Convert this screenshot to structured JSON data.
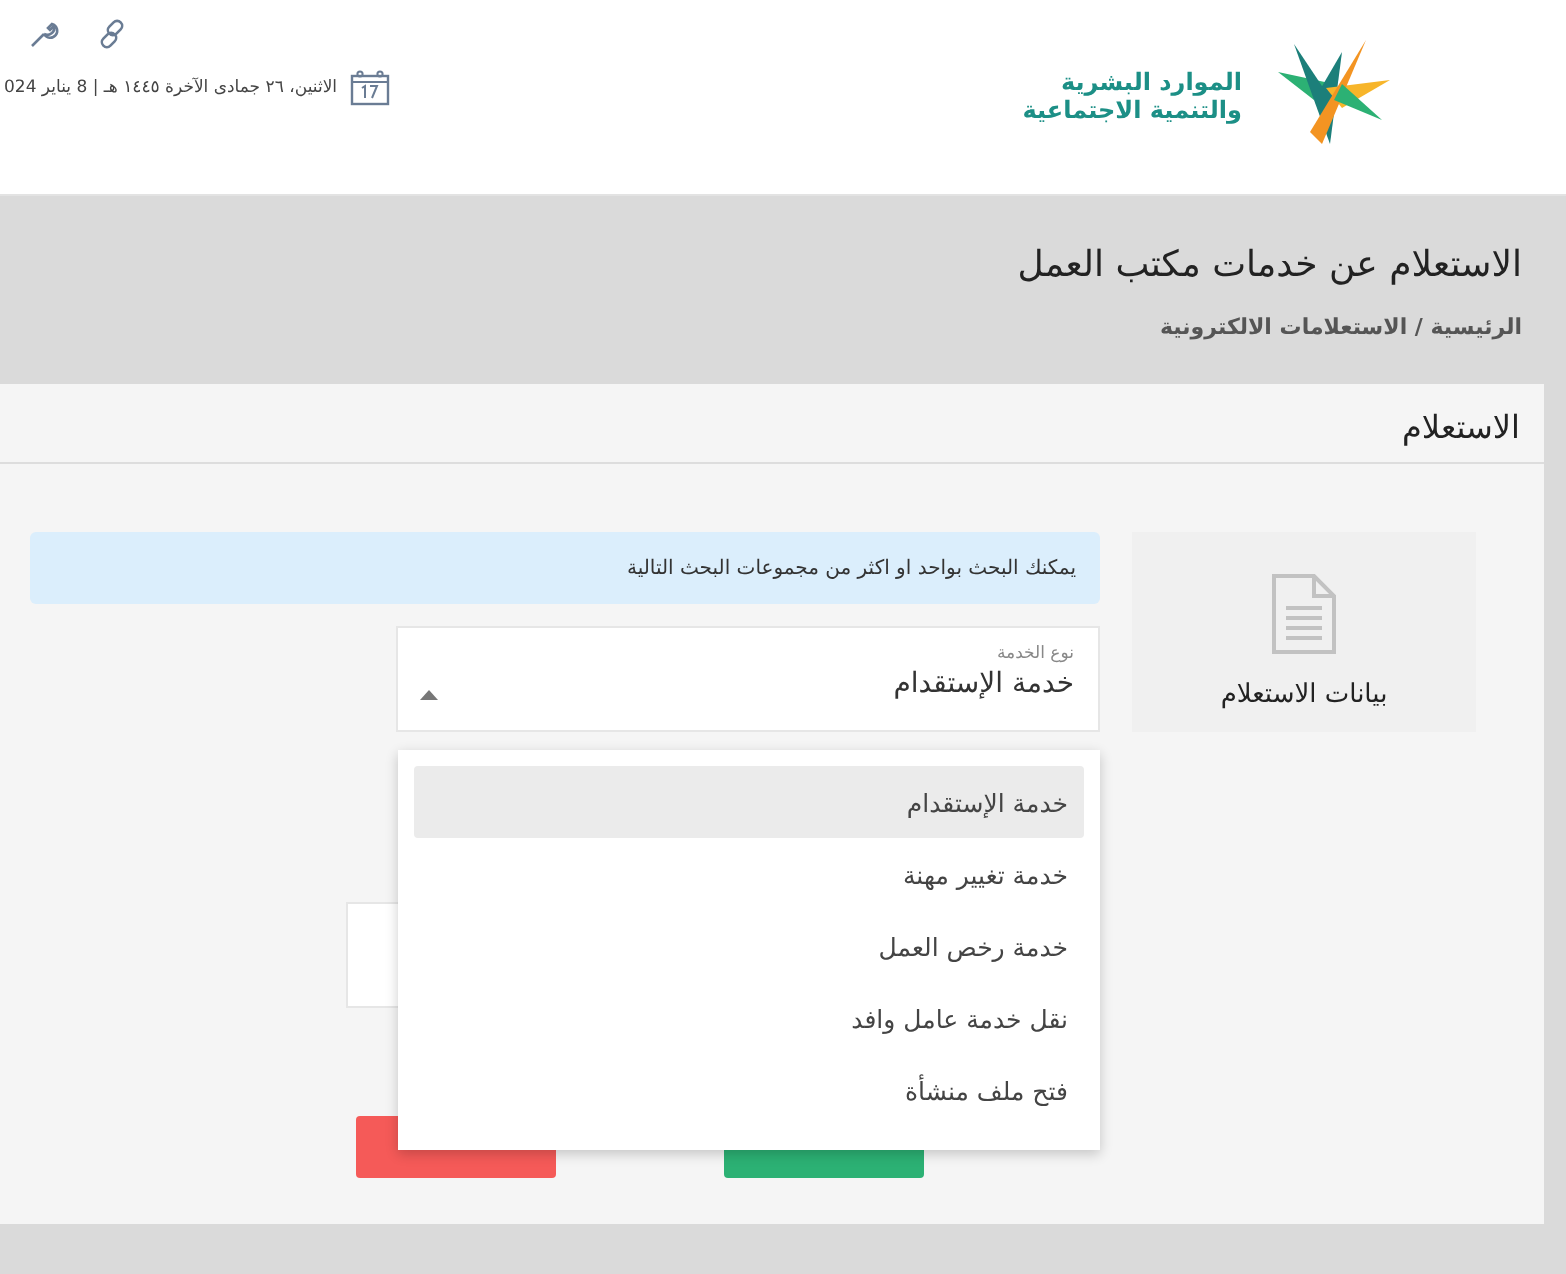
{
  "header": {
    "logo_lines": [
      "الموارد البشرية",
      "والتنمية الاجتماعية"
    ],
    "date": "الاثنين، ٢٦ جمادى الآخرة ١٤٤٥ هـ | 8 يناير 024"
  },
  "page": {
    "title": "الاستعلام عن خدمات مكتب العمل",
    "breadcrumb": "الرئيسية / الاستعلامات الالكترونية"
  },
  "card": {
    "title": "الاستعلام",
    "side_tab": "بيانات الاستعلام",
    "alert": "يمكنك البحث بواحد او اكثر من مجموعات البحث التالية",
    "select": {
      "label": "نوع الخدمة",
      "value": "خدمة الإستقدام",
      "expanded": true,
      "options": [
        {
          "label": "خدمة الإستقدام",
          "selected": true
        },
        {
          "label": "خدمة تغيير مهنة",
          "selected": false
        },
        {
          "label": "خدمة رخص العمل",
          "selected": false
        },
        {
          "label": "نقل خدمة عامل وافد",
          "selected": false
        },
        {
          "label": "فتح ملف منشأة",
          "selected": false
        }
      ]
    },
    "buttons": [
      {
        "kind": "search"
      },
      {
        "kind": "clear"
      }
    ]
  }
}
